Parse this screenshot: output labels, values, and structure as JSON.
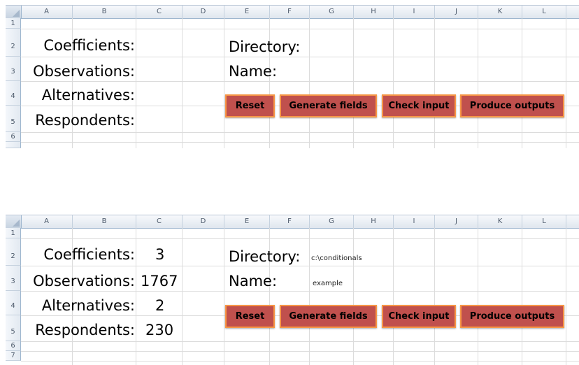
{
  "columns": [
    "A",
    "B",
    "C",
    "D",
    "E",
    "F",
    "G",
    "H",
    "I",
    "J",
    "K",
    "L"
  ],
  "sheet1": {
    "rows": [
      "1",
      "2",
      "3",
      "4",
      "5",
      "6"
    ],
    "labels": {
      "coefficients": "Coefficients:",
      "observations": "Observations:",
      "alternatives": "Alternatives:",
      "respondents": "Respondents:",
      "directory": "Directory:",
      "name": "Name:"
    },
    "buttons": {
      "reset": "Reset",
      "generate": "Generate fields",
      "check": "Check input",
      "produce": "Produce outputs"
    }
  },
  "sheet2": {
    "rows": [
      "1",
      "2",
      "3",
      "4",
      "5",
      "6",
      "7"
    ],
    "labels": {
      "coefficients": "Coefficients:",
      "observations": "Observations:",
      "alternatives": "Alternatives:",
      "respondents": "Respondents:",
      "directory": "Directory:",
      "name": "Name:"
    },
    "values": {
      "coefficients": "3",
      "observations": "1767",
      "alternatives": "2",
      "respondents": "230",
      "directory": "c:\\conditionals",
      "name": "example"
    },
    "buttons": {
      "reset": "Reset",
      "generate": "Generate fields",
      "check": "Check input",
      "produce": "Produce outputs"
    }
  }
}
